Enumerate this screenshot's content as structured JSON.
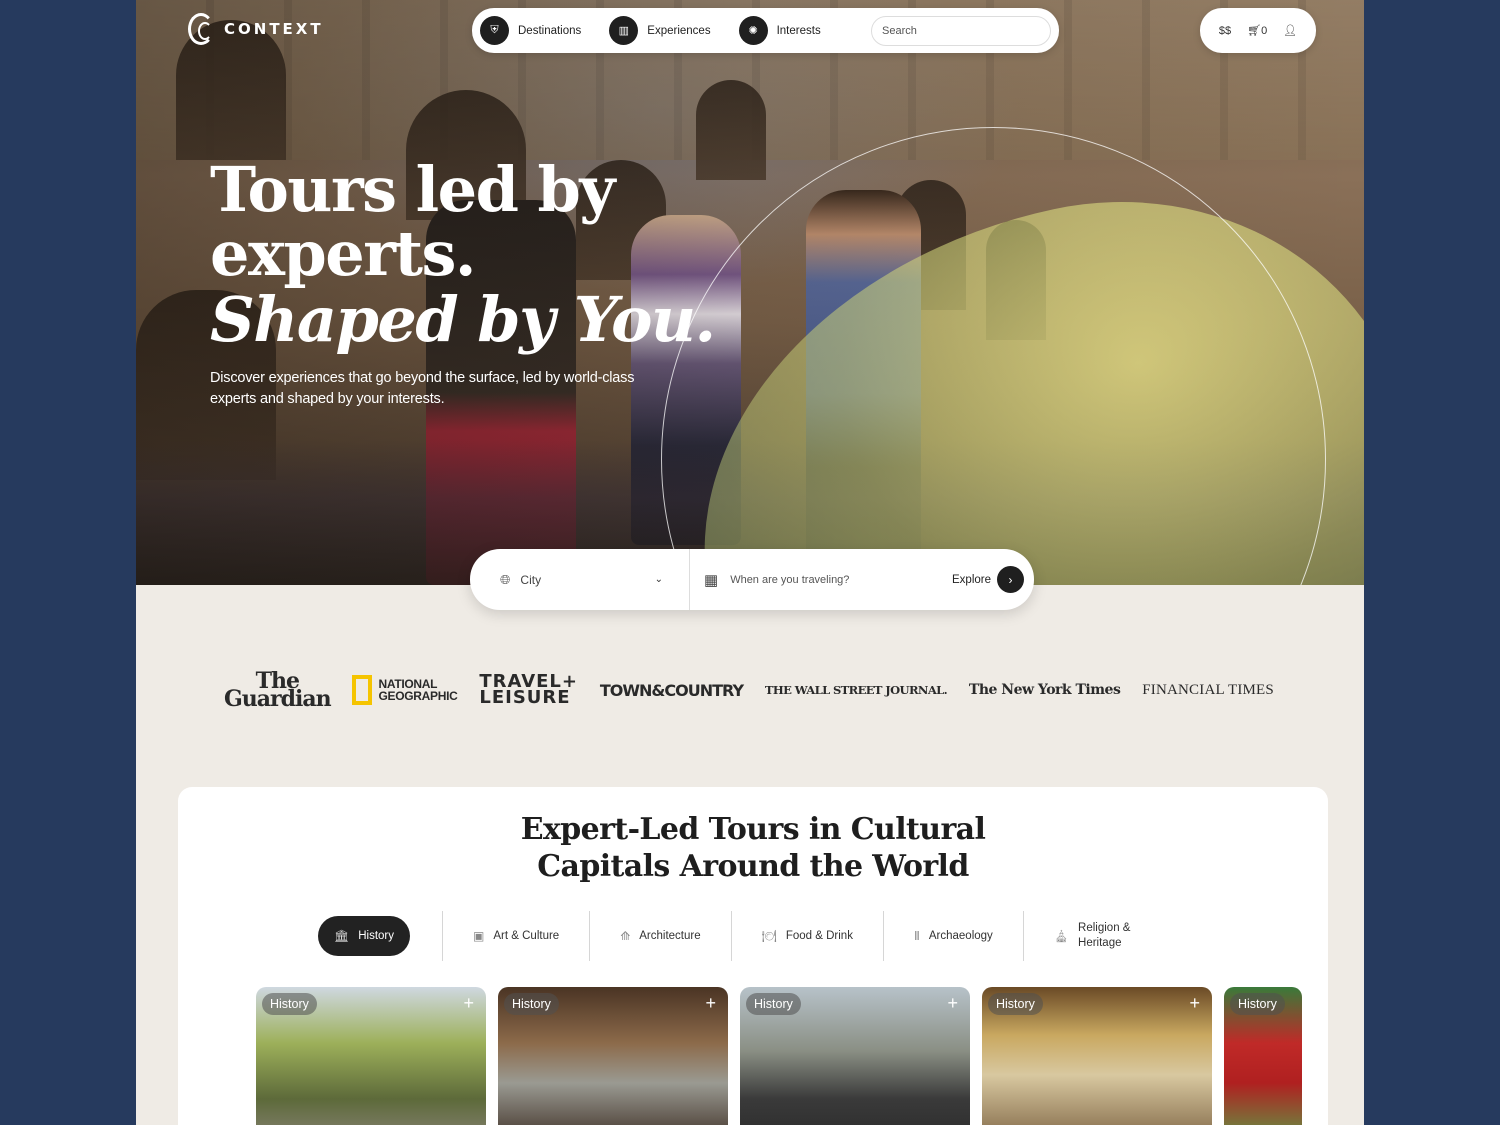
{
  "header": {
    "logo": "CONTEXT",
    "nav": [
      {
        "label": "Destinations",
        "icon": "shield-icon"
      },
      {
        "label": "Experiences",
        "icon": "map-icon"
      },
      {
        "label": "Interests",
        "icon": "compass-icon"
      }
    ],
    "search_placeholder": "Search",
    "currency": "$$",
    "cart_count": "0"
  },
  "hero": {
    "line1": "Tours led by",
    "line2": "experts.",
    "line3": "Shaped by You.",
    "lede": "Discover experiences that go beyond the surface, led by world-class experts and shaped by your interests."
  },
  "booking": {
    "city_label": "City",
    "date_label": "When are you traveling?",
    "explore_label": "Explore"
  },
  "press": {
    "guardian_1": "The",
    "guardian_2": "Guardian",
    "natgeo_1": "NATIONAL",
    "natgeo_2": "GEOGRAPHIC",
    "tl_1": "TRAVEL+",
    "tl_2": "LEISURE",
    "tc": "TOWN&COUNTRY",
    "wsj": "THE WALL STREET JOURNAL.",
    "nyt": "The New York Times",
    "ft": "FINANCIAL TIMES"
  },
  "tours_section": {
    "title_1": "Expert-Led Tours in Cultural",
    "title_2": "Capitals Around the World",
    "categories": [
      {
        "label": "History",
        "active": true
      },
      {
        "label": "Art & Culture"
      },
      {
        "label": "Architecture"
      },
      {
        "label": "Food & Drink"
      },
      {
        "label": "Archaeology"
      },
      {
        "label": "Religion &",
        "label2": "Heritage"
      }
    ],
    "cards": [
      {
        "tag": "History"
      },
      {
        "tag": "History"
      },
      {
        "tag": "History"
      },
      {
        "tag": "History"
      },
      {
        "tag": "History"
      }
    ]
  },
  "colors": {
    "frame": "#263a5e",
    "page": "#efebe5",
    "dark": "#1f1f1f",
    "natgeo": "#f5c400"
  }
}
